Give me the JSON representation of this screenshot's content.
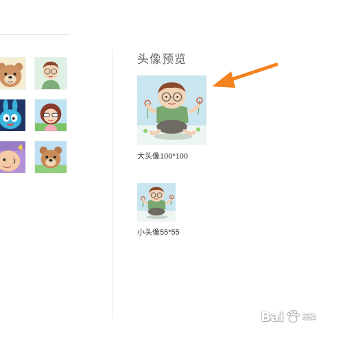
{
  "preview": {
    "title": "头像预览",
    "large_caption": "大头像100*100",
    "small_caption": "小头像55*55"
  },
  "avatar_grid": {
    "rows": [
      [
        "bear-avatar",
        "bald-man-avatar"
      ],
      [
        "blue-bunny-avatar",
        "sunglasses-girl-avatar"
      ],
      [
        "purple-character-avatar",
        "bear-avatar-2"
      ]
    ]
  },
  "colors": {
    "arrow": "#f58220",
    "divider": "#e5e5e5",
    "preview_bg": "#c9e6f0"
  },
  "watermark": {
    "text": "Bai",
    "sub": "经验"
  }
}
